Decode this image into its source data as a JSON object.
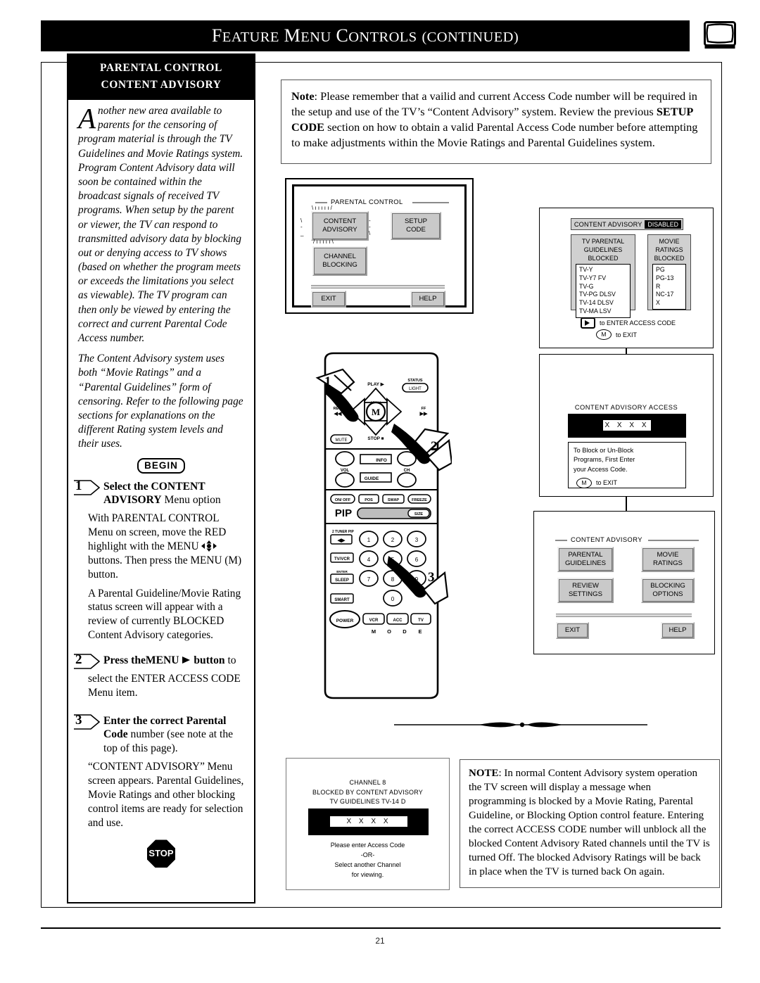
{
  "header": {
    "title_words": [
      "Feature",
      "Menu",
      "Controls",
      "(continued)"
    ],
    "corner_icon": "tv-icon"
  },
  "page": {
    "number": "21"
  },
  "left_column": {
    "heading_line1": "PARENTAL CONTROL",
    "heading_line2": "CONTENT ADVISORY",
    "dropcap": "A",
    "intro_paragraph_1": "nother new area available to parents for the censoring of program material is through the TV Guidelines and Movie Ratings system. Program Content Advisory data will soon be contained within the broadcast signals of received TV programs. When setup by the parent or viewer, the TV can respond to transmitted advisory data by blocking out or denying access to TV shows (based on whether the program meets or exceeds the limitations you select as viewable). The TV program can then only be viewed by entering the correct and current Parental Code Access number.",
    "intro_paragraph_2": "The Content Advisory system uses both “Movie Ratings” and a “Parental Guidelines” form of censoring. Refer to the following page sections for explanations on the different Rating system levels and their uses.",
    "begin_badge": "BEGIN",
    "stop_badge": "STOP",
    "steps": [
      {
        "number": "1",
        "title_bold": "Select the CONTENT ADVISORY",
        "title_rest": " Menu option",
        "body_1": "With PARENTAL CONTROL Menu on screen, move the RED highlight with the MENU",
        "body_1b": "buttons. Then press the MENU (M) button.",
        "body_2": "A Parental Guideline/Movie Rating status screen will appear with a review of currently BLOCKED Content Advisory categories."
      },
      {
        "number": "2",
        "title_bold": "Press theMENU",
        "title_bold2": "button",
        "title_rest": " to",
        "body_1": "select the ENTER ACCESS CODE Menu item."
      },
      {
        "number": "3",
        "title_bold": "Enter the correct Parental Code",
        "title_rest": " number (see note at the top of this page).",
        "body_1": "“CONTENT ADVISORY” Menu screen appears. Parental Guidelines, Movie Ratings and other blocking control items are ready for selection and use."
      }
    ]
  },
  "note_top": {
    "label": "Note",
    "text_1": ": Please remember that a vailid and current Access Code number will be required in the setup and use of the TV’s “Content Advisory” system. Review the previous ",
    "bold_ref": "SETUP CODE",
    "text_2": " section on how to obtain a valid Parental Access Code number before attempting to make adjustments within the Movie Ratings and Parental Guidelines system."
  },
  "note_bottom": {
    "label": "NOTE",
    "text": ": In normal Content Advisory system operation the TV screen will display a message when programming is blocked by a Movie Rating, Parental Guideline, or Blocking Option control feature. Entering the correct ACCESS CODE number will unblock all the blocked Content Advisory Rated channels until the TV is turned Off. The blocked Advisory Ratings will be back in place when the TV is turned back On again."
  },
  "tv_menu_parental_control": {
    "title": "PARENTAL CONTROL",
    "buttons": {
      "content_advisory_l1": "CONTENT",
      "content_advisory_l2": "ADVISORY",
      "setup_code_l1": "SETUP",
      "setup_code_l2": "CODE",
      "channel_blocking_l1": "CHANNEL",
      "channel_blocking_l2": "BLOCKING",
      "exit": "EXIT",
      "help": "HELP"
    }
  },
  "panel_content_advisory_status": {
    "header_label": "CONTENT ADVISORY",
    "header_state": "DISABLED",
    "tv_guidelines": {
      "head_l1": "TV PARENTAL",
      "head_l2": "GUIDELINES",
      "head_l3": "BLOCKED",
      "items": [
        "TV-Y",
        "TV-Y7  FV",
        "TV-G",
        "TV-PG DLSV",
        "TV-14  DLSV",
        "TV-MA LSV"
      ]
    },
    "movie_ratings": {
      "head_l1": "MOVIE",
      "head_l2": "RATINGS",
      "head_l3": "BLOCKED",
      "items": [
        "PG",
        "PG-13",
        "R",
        "NC-17",
        "X"
      ]
    },
    "key_hint_1": "to ENTER ACCESS CODE",
    "key_hint_2": "to EXIT",
    "key_m": "M"
  },
  "panel_content_advisory_access": {
    "title": "CONTENT ADVISORY ACCESS",
    "code_value": "X X X X",
    "message_l1": "To Block or Un-Block",
    "message_l2": "Programs, First Enter",
    "message_l3": "your Access Code.",
    "key_m": "M",
    "key_hint": "to EXIT"
  },
  "panel_content_advisory_menu": {
    "title": "CONTENT ADVISORY",
    "buttons": {
      "parental_guidelines_l1": "PARENTAL",
      "parental_guidelines_l2": "GUIDELINES",
      "movie_ratings_l1": "MOVIE",
      "movie_ratings_l2": "RATINGS",
      "review_settings_l1": "REVIEW",
      "review_settings_l2": "SETTINGS",
      "blocking_options_l1": "BLOCKING",
      "blocking_options_l2": "OPTIONS",
      "exit": "EXIT",
      "help": "HELP"
    }
  },
  "blocked_screen": {
    "line_1": "CHANNEL 8",
    "line_2": "BLOCKED BY CONTENT ADVISORY",
    "line_3": "TV GUIDELINES TV-14  D",
    "code_value": "X X X X",
    "foot_1": "Please enter Access Code",
    "foot_2": "-OR-",
    "foot_3": "Select another Channel",
    "foot_4": "for viewing."
  },
  "remote": {
    "callouts": [
      "1",
      "2",
      "3"
    ],
    "labels": {
      "play": "PLAY",
      "status": "STATUS",
      "light": "LIGHT",
      "rew": "REW",
      "ff": "FF",
      "menu_m": "M",
      "menu": "MENU",
      "mute": "MUTE",
      "stop": "STOP",
      "vol": "VOL",
      "ch": "CH",
      "info": "INFO",
      "guide": "GUIDE",
      "on_off": "ON/ OFF",
      "pos": "POS",
      "swap": "SWAP",
      "freeze": "FREEZE",
      "pip": "PIP",
      "size": "SIZE",
      "tuner_pip": "2 TUNER PIP",
      "tv_vcr": "TV/VCR",
      "enter": "ENTER",
      "sleep": "SLEEP",
      "smart": "SMART",
      "power": "POWER",
      "vcr": "VCR",
      "acc": "ACC",
      "tv": "TV",
      "mode": [
        "M",
        "O",
        "D",
        "E"
      ],
      "keypad": [
        "1",
        "2",
        "3",
        "4",
        "5",
        "6",
        "7",
        "8",
        "9",
        "0"
      ]
    }
  },
  "colors": {
    "ink": "#000000",
    "panel_grey": "#d0d0d0",
    "swoosh_grey": "#cfcfcf"
  }
}
